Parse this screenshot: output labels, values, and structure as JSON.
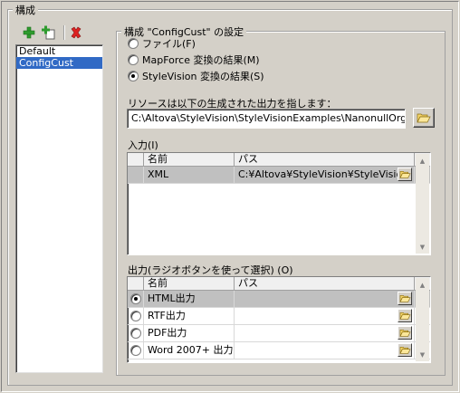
{
  "dialog": {
    "group_title": "構成"
  },
  "toolbar": {
    "add_icon": "plus-icon",
    "copy_icon": "copy-plus-icon",
    "delete_icon": "delete-x-icon"
  },
  "config_list": {
    "items": [
      {
        "label": "Default",
        "selected": false
      },
      {
        "label": "ConfigCust",
        "selected": true
      }
    ]
  },
  "settings": {
    "title": "構成 \"ConfigCust\" の設定",
    "source_options": [
      {
        "label": "ファイル(F)",
        "checked": false
      },
      {
        "label": "MapForce 変換の結果(M)",
        "checked": false
      },
      {
        "label": "StyleVision 変換の結果(S)",
        "checked": true
      }
    ],
    "resource_label": "リソースは以下の生成された出力を指します：",
    "resource_path": "C:\\Altova\\StyleVision\\StyleVisionExamples\\NanonullOrg.sps"
  },
  "inputs": {
    "label": "入力(I)",
    "columns": [
      "名前",
      "パス"
    ],
    "rows": [
      {
        "name": "XML",
        "path": "C:¥Altova¥StyleVision¥StyleVision"
      }
    ]
  },
  "outputs": {
    "label": "出力(ラジオボタンを使って選択) (O)",
    "columns": [
      "名前",
      "パス"
    ],
    "rows": [
      {
        "name": "HTML出力",
        "path": "",
        "checked": true
      },
      {
        "name": "RTF出力",
        "path": "",
        "checked": false
      },
      {
        "name": "PDF出力",
        "path": "",
        "checked": false
      },
      {
        "name": "Word 2007+ 出力",
        "path": "",
        "checked": false
      }
    ]
  },
  "colors": {
    "selection": "#316ac5",
    "dialog_bg": "#d4d0c8"
  }
}
